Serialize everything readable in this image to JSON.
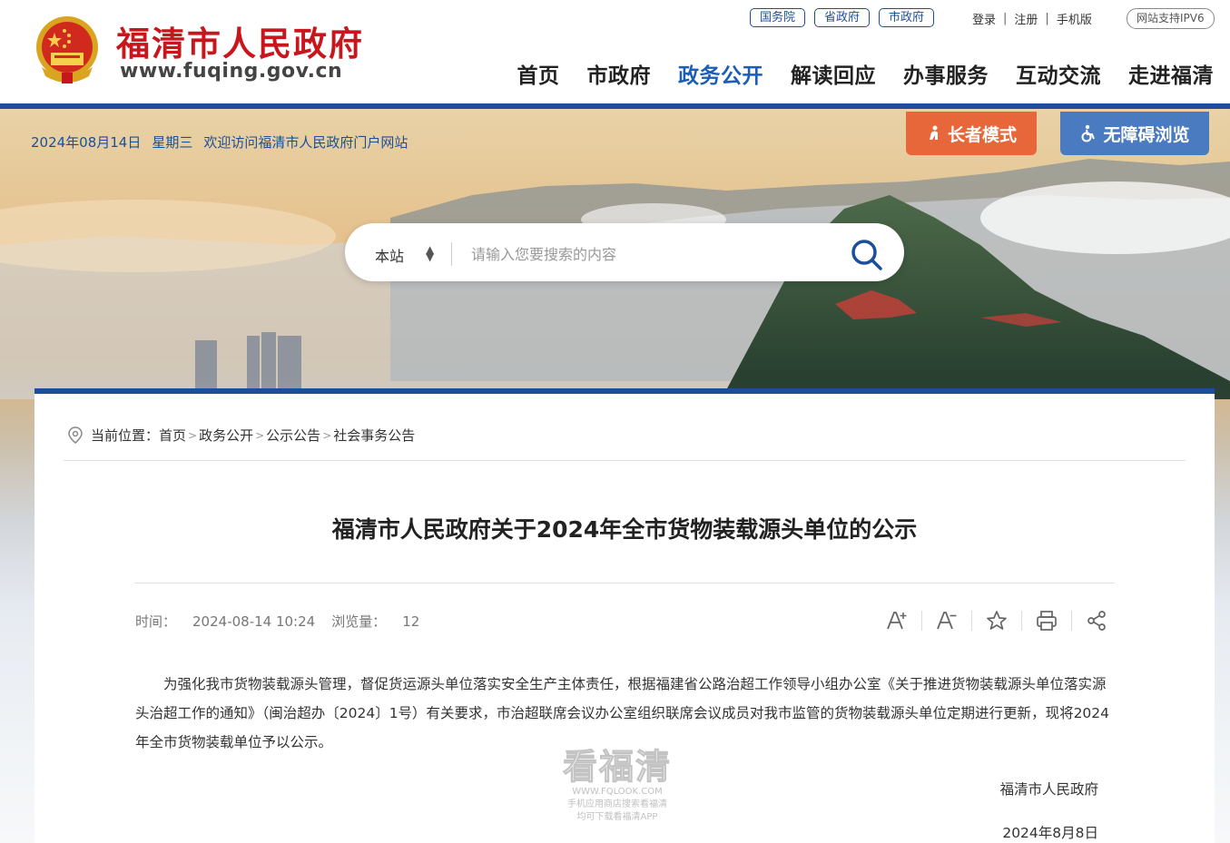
{
  "header": {
    "site_name": "福清市人民政府",
    "site_url": "www.fuqing.gov.cn",
    "top_links": [
      "国务院",
      "省政府",
      "市政府"
    ],
    "user_links": [
      "登录",
      "注册",
      "手机版"
    ],
    "ipv6_badge": "网站支持IPV6",
    "nav": [
      "首页",
      "市政府",
      "政务公开",
      "解读回应",
      "办事服务",
      "互动交流",
      "走进福清"
    ],
    "active_nav": "政务公开"
  },
  "banner": {
    "date": "2024年08月14日",
    "weekday": "星期三",
    "welcome": "欢迎访问福清市人民政府门户网站",
    "elder_mode": "长者模式",
    "accessible": "无障碍浏览"
  },
  "search": {
    "scope": "本站",
    "placeholder": "请输入您要搜索的内容",
    "value": ""
  },
  "breadcrumb": {
    "label": "当前位置：",
    "items": [
      "首页",
      "政务公开",
      "公示公告",
      "社会事务公告"
    ]
  },
  "article": {
    "title": "福清市人民政府关于2024年全市货物装载源头单位的公示",
    "time_label": "时间：",
    "time": "2024-08-14 10:24",
    "views_label": "浏览量：",
    "views": "12",
    "body": "为强化我市货物装载源头管理，督促货运源头单位落实安全生产主体责任，根据福建省公路治超工作领导小组办公室《关于推进货物装载源头单位落实源头治超工作的通知》（闽治超办〔2024〕1号）有关要求，市治超联席会议办公室组织联席会议成员对我市监管的货物装载源头单位定期进行更新，现将2024年全市货物装载单位予以公示。",
    "signature": "福清市人民政府",
    "sign_date": "2024年8月8日"
  },
  "tools": [
    "font-increase-icon",
    "font-decrease-icon",
    "star-icon",
    "print-icon",
    "share-icon"
  ],
  "watermark": {
    "big": "看福清",
    "url": "WWW.FQLOOK.COM",
    "line1": "手机应用商店搜索看福清",
    "line2": "均可下载看福清APP"
  },
  "colors": {
    "brand_red": "#c8161d",
    "brand_blue": "#1c4f99",
    "elder_orange": "#e8673a",
    "access_blue": "#4a7bc0"
  }
}
